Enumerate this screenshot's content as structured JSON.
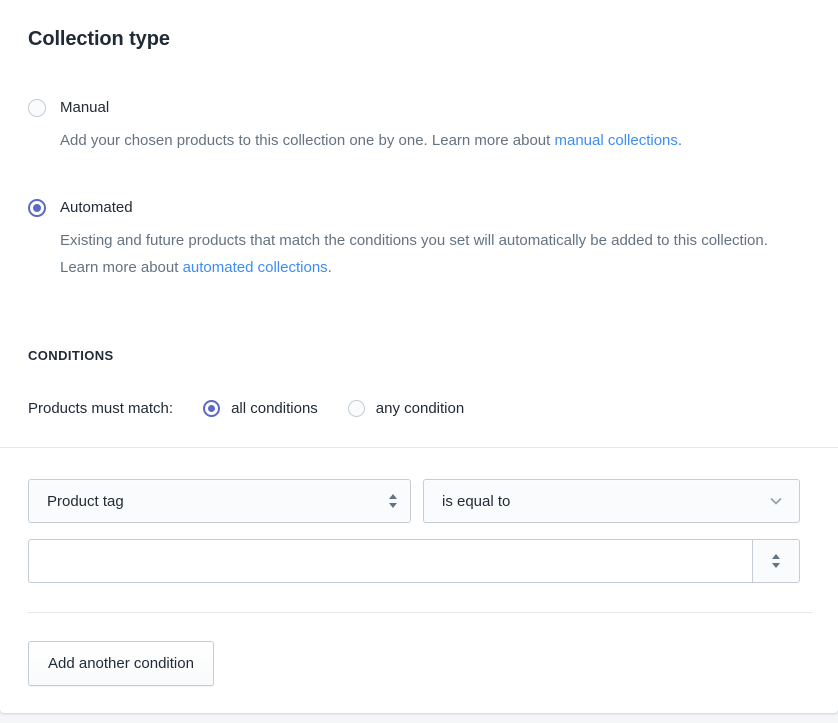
{
  "card": {
    "section_title": "Collection type"
  },
  "collection_type": {
    "options": [
      {
        "id": "manual",
        "label": "Manual",
        "selected": false,
        "help_prefix": "Add your chosen products to this collection one by one. Learn more about ",
        "help_link": "manual collections",
        "help_suffix": "."
      },
      {
        "id": "automated",
        "label": "Automated",
        "selected": true,
        "help_prefix": "Existing and future products that match the conditions you set will automatically be added to this collection. Learn more about ",
        "help_link": "automated collections",
        "help_suffix": "."
      }
    ]
  },
  "conditions": {
    "heading": "CONDITIONS",
    "match_label": "Products must match:",
    "match_options": [
      {
        "id": "all",
        "label": "all conditions",
        "selected": true
      },
      {
        "id": "any",
        "label": "any condition",
        "selected": false
      }
    ],
    "rows": [
      {
        "field_value": "Product tag",
        "field_icon": "up-down-arrows-icon",
        "relation_value": "is equal to",
        "relation_icon": "chevron-down-icon",
        "value_text": "",
        "value_placeholder": "",
        "value_stepper_icon": "up-down-arrows-icon"
      }
    ],
    "add_button_label": "Add another condition"
  },
  "colors": {
    "accent": "#5c6ac4",
    "link": "#3d8df5",
    "text": "#212b36",
    "muted_text": "#637381",
    "border": "#c4cdd5",
    "divider": "#e6e9ec",
    "field_bg": "#fafbfc",
    "card_bg": "#ffffff",
    "page_bg": "#f4f6f8"
  }
}
